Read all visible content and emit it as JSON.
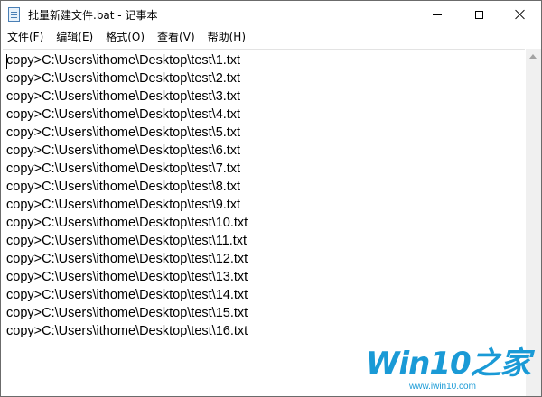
{
  "window": {
    "title": "批量新建文件.bat - 记事本"
  },
  "menu": {
    "items": [
      "文件(F)",
      "编辑(E)",
      "格式(O)",
      "查看(V)",
      "帮助(H)"
    ]
  },
  "editor": {
    "lines": [
      "copy>C:\\Users\\ithome\\Desktop\\test\\1.txt",
      "copy>C:\\Users\\ithome\\Desktop\\test\\2.txt",
      "copy>C:\\Users\\ithome\\Desktop\\test\\3.txt",
      "copy>C:\\Users\\ithome\\Desktop\\test\\4.txt",
      "copy>C:\\Users\\ithome\\Desktop\\test\\5.txt",
      "copy>C:\\Users\\ithome\\Desktop\\test\\6.txt",
      "copy>C:\\Users\\ithome\\Desktop\\test\\7.txt",
      "copy>C:\\Users\\ithome\\Desktop\\test\\8.txt",
      "copy>C:\\Users\\ithome\\Desktop\\test\\9.txt",
      "copy>C:\\Users\\ithome\\Desktop\\test\\10.txt",
      "copy>C:\\Users\\ithome\\Desktop\\test\\11.txt",
      "copy>C:\\Users\\ithome\\Desktop\\test\\12.txt",
      "copy>C:\\Users\\ithome\\Desktop\\test\\13.txt",
      "copy>C:\\Users\\ithome\\Desktop\\test\\14.txt",
      "copy>C:\\Users\\ithome\\Desktop\\test\\15.txt",
      "copy>C:\\Users\\ithome\\Desktop\\test\\16.txt"
    ]
  },
  "watermark": {
    "logo": "Win10之家",
    "url": "www.iwin10.com"
  },
  "icons": {
    "app": "notepad-icon",
    "minimize": "minimize-icon",
    "maximize": "maximize-icon",
    "close": "close-icon",
    "scroll_up": "arrow-up-icon"
  },
  "colors": {
    "watermark": "#1a9ad6",
    "scrollbar": "#f0f0f0"
  }
}
